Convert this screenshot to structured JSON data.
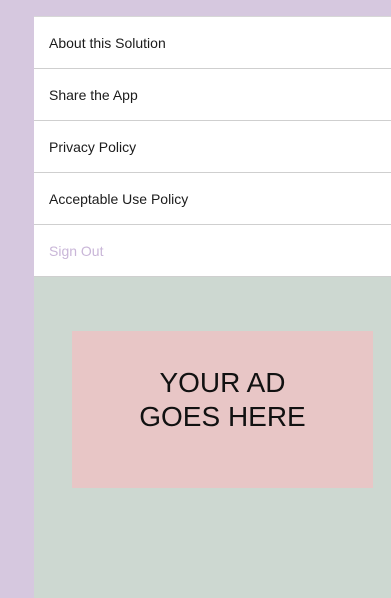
{
  "menu": {
    "items": [
      {
        "label": "About this Solution"
      },
      {
        "label": "Share the App"
      },
      {
        "label": "Privacy Policy"
      },
      {
        "label": "Acceptable Use Policy"
      },
      {
        "label": "Sign Out"
      }
    ]
  },
  "ad": {
    "text": "YOUR AD\nGOES HERE"
  },
  "colors": {
    "page_background": "#d6c8df",
    "panel_background": "#cdd8d1",
    "menu_background": "#ffffff",
    "signout_text": "#c9b6d8",
    "ad_background": "#e8c6c6"
  }
}
